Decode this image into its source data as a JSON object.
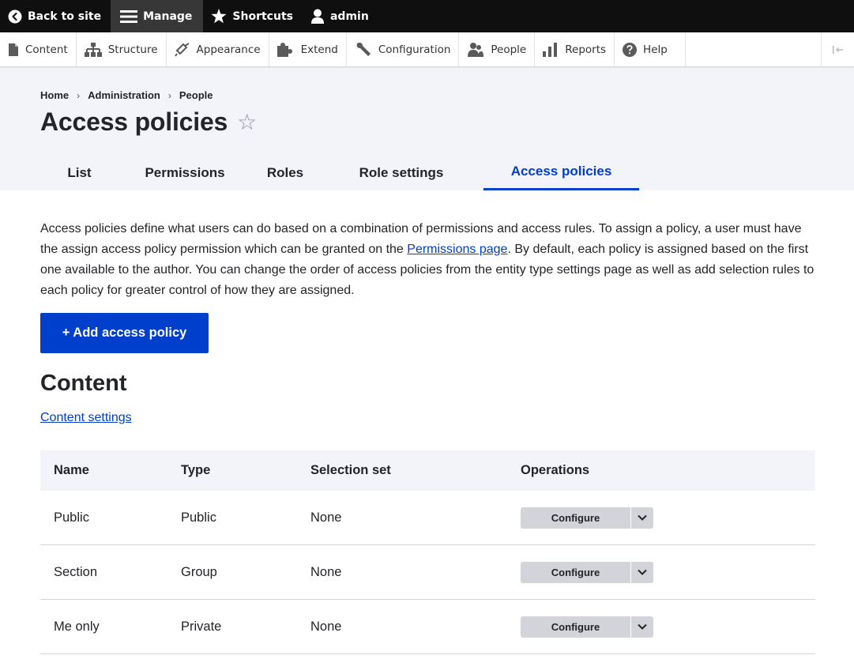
{
  "toolbar": {
    "back_to_site": "Back to site",
    "manage": "Manage",
    "shortcuts": "Shortcuts",
    "user": "admin"
  },
  "tray": {
    "items": [
      "Content",
      "Structure",
      "Appearance",
      "Extend",
      "Configuration",
      "People",
      "Reports",
      "Help"
    ]
  },
  "breadcrumb": [
    "Home",
    "Administration",
    "People"
  ],
  "breadcrumb_separator": "›",
  "page_title": "Access policies",
  "tabs": [
    "List",
    "Permissions",
    "Roles",
    "Role settings",
    "Access policies"
  ],
  "active_tab": "Access policies",
  "description": {
    "part1": "Access policies define what users can do based on a combination of permissions and access rules. To assign a policy, a user must have the assign access policy permission which can be granted on the ",
    "link": "Permissions page",
    "part2": ". By default, each policy is assigned based on the first one available to the author. You can change the order of access policies from the entity type settings page as well as add selection rules to each policy for greater control of how they are assigned."
  },
  "add_button": "+ Add access policy",
  "section_title": "Content",
  "settings_link": "Content settings",
  "table": {
    "headers": [
      "Name",
      "Type",
      "Selection set",
      "Operations"
    ],
    "rows": [
      {
        "name": "Public",
        "type": "Public",
        "selection": "None",
        "operation": "Configure"
      },
      {
        "name": "Section",
        "type": "Group",
        "selection": "None",
        "operation": "Configure"
      },
      {
        "name": "Me only",
        "type": "Private",
        "selection": "None",
        "operation": "Configure"
      }
    ]
  },
  "colors": {
    "accent": "#003ecc",
    "toolbar_bg": "#0f0f0f",
    "header_bg": "#f3f4f9"
  }
}
